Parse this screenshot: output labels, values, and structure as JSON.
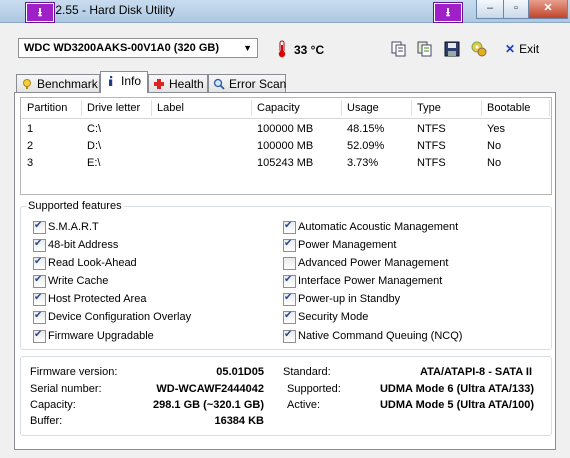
{
  "window": {
    "title": "une 2.55 - Hard Disk Utility",
    "overlay_icon": "download-arrow-icon",
    "controls": [
      "minimize-icon",
      "maximize-icon",
      "close-icon"
    ]
  },
  "toolbar": {
    "drive_selected": "WDC WD3200AAKS-00V1A0 (320 GB)",
    "temperature": "33 °C",
    "icons": [
      "copy-icon",
      "copy-all-icon",
      "save-icon",
      "options-icon"
    ],
    "exit_label": "Exit"
  },
  "tabs": [
    {
      "label": "Benchmark",
      "icon": "benchmark-icon"
    },
    {
      "label": "Info",
      "icon": "info-icon",
      "active": true
    },
    {
      "label": "Health",
      "icon": "health-icon"
    },
    {
      "label": "Error Scan",
      "icon": "magnifier-icon"
    }
  ],
  "partitions": {
    "columns": [
      "Partition",
      "Drive letter",
      "Label",
      "Capacity",
      "Usage",
      "Type",
      "Bootable"
    ],
    "rows": [
      [
        "1",
        "C:\\",
        "",
        "100000 MB",
        "48.15%",
        "NTFS",
        "Yes"
      ],
      [
        "2",
        "D:\\",
        "",
        "100000 MB",
        "52.09%",
        "NTFS",
        "No"
      ],
      [
        "3",
        "E:\\",
        "",
        "105243 MB",
        "3.73%",
        "NTFS",
        "No"
      ]
    ]
  },
  "features": {
    "title": "Supported features",
    "left": [
      {
        "label": "S.M.A.R.T",
        "checked": true
      },
      {
        "label": "48-bit Address",
        "checked": true
      },
      {
        "label": "Read Look-Ahead",
        "checked": true
      },
      {
        "label": "Write Cache",
        "checked": true
      },
      {
        "label": "Host Protected Area",
        "checked": true
      },
      {
        "label": "Device Configuration Overlay",
        "checked": true
      },
      {
        "label": "Firmware Upgradable",
        "checked": true
      }
    ],
    "right": [
      {
        "label": "Automatic Acoustic Management",
        "checked": true
      },
      {
        "label": "Power Management",
        "checked": true
      },
      {
        "label": "Advanced Power Management",
        "checked": false
      },
      {
        "label": "Interface Power Management",
        "checked": true
      },
      {
        "label": "Power-up in Standby",
        "checked": true
      },
      {
        "label": "Security Mode",
        "checked": true
      },
      {
        "label": "Native Command Queuing (NCQ)",
        "checked": true
      }
    ]
  },
  "info": {
    "firmware_label": "Firmware version:",
    "firmware": "05.01D05",
    "serial_label": "Serial number:",
    "serial": "WD-WCAWF2444042",
    "capacity_label": "Capacity:",
    "capacity": "298.1 GB (~320.1 GB)",
    "buffer_label": "Buffer:",
    "buffer": "16384 KB",
    "standard_label": "Standard:",
    "standard": "ATA/ATAPI-8 - SATA II",
    "supported_label": "Supported:",
    "supported": "UDMA Mode 6 (Ultra ATA/133)",
    "active_label": "Active:",
    "active": "UDMA Mode 5 (Ultra ATA/100)"
  },
  "colors": {
    "overlay_purple": "#a020c8",
    "panel_bg": "#ffffff"
  }
}
